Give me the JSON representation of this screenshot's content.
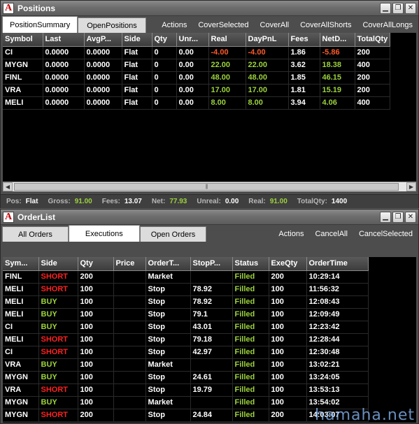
{
  "positions_window": {
    "title": "Positions",
    "tabs": [
      "PositionSummary",
      "OpenPositions"
    ],
    "actions": [
      "Actions",
      "CoverSelected",
      "CoverAll",
      "CoverAllShorts",
      "CoverAllLongs"
    ],
    "columns": [
      "Symbol",
      "Last",
      "AvgP...",
      "Side",
      "Qty",
      "Unr...",
      "Real",
      "DayPnL",
      "Fees",
      "NetD...",
      "TotalQty"
    ],
    "rows": [
      {
        "symbol": "CI",
        "last": "0.0000",
        "avg": "0.0000",
        "side": "Flat",
        "qty": "0",
        "unr": "0.00",
        "real": "-4.00",
        "daypnl": "-4.00",
        "fees": "1.86",
        "net": "-5.86",
        "total": "200"
      },
      {
        "symbol": "MYGN",
        "last": "0.0000",
        "avg": "0.0000",
        "side": "Flat",
        "qty": "0",
        "unr": "0.00",
        "real": "22.00",
        "daypnl": "22.00",
        "fees": "3.62",
        "net": "18.38",
        "total": "400"
      },
      {
        "symbol": "FINL",
        "last": "0.0000",
        "avg": "0.0000",
        "side": "Flat",
        "qty": "0",
        "unr": "0.00",
        "real": "48.00",
        "daypnl": "48.00",
        "fees": "1.85",
        "net": "46.15",
        "total": "200"
      },
      {
        "symbol": "VRA",
        "last": "0.0000",
        "avg": "0.0000",
        "side": "Flat",
        "qty": "0",
        "unr": "0.00",
        "real": "17.00",
        "daypnl": "17.00",
        "fees": "1.81",
        "net": "15.19",
        "total": "200"
      },
      {
        "symbol": "MELI",
        "last": "0.0000",
        "avg": "0.0000",
        "side": "Flat",
        "qty": "0",
        "unr": "0.00",
        "real": "8.00",
        "daypnl": "8.00",
        "fees": "3.94",
        "net": "4.06",
        "total": "400"
      }
    ],
    "status": {
      "pos_label": "Pos:",
      "pos_value": "Flat",
      "gross_label": "Gross:",
      "gross_value": "91.00",
      "fees_label": "Fees:",
      "fees_value": "13.07",
      "net_label": "Net:",
      "net_value": "77.93",
      "unreal_label": "Unreal:",
      "unreal_value": "0.00",
      "real_label": "Real:",
      "real_value": "91.00",
      "totalqty_label": "TotalQty:",
      "totalqty_value": "1400"
    }
  },
  "orders_window": {
    "title": "OrderList",
    "tabs": [
      "All Orders",
      "Executions",
      "Open Orders"
    ],
    "actions": [
      "Actions",
      "CancelAll",
      "CancelSelected"
    ],
    "columns": [
      "Sym...",
      "Side",
      "Qty",
      "Price",
      "OrderT...",
      "StopP...",
      "Status",
      "ExeQty",
      "OrderTime"
    ],
    "rows": [
      {
        "sym": "FINL",
        "side": "SHORT",
        "qty": "200",
        "price": "",
        "type": "Market",
        "stop": "",
        "status": "Filled",
        "exe": "200",
        "time": "10:29:14"
      },
      {
        "sym": "MELI",
        "side": "SHORT",
        "qty": "100",
        "price": "",
        "type": "Stop",
        "stop": "78.92",
        "status": "Filled",
        "exe": "100",
        "time": "11:56:32"
      },
      {
        "sym": "MELI",
        "side": "BUY",
        "qty": "100",
        "price": "",
        "type": "Stop",
        "stop": "78.92",
        "status": "Filled",
        "exe": "100",
        "time": "12:08:43"
      },
      {
        "sym": "MELI",
        "side": "BUY",
        "qty": "100",
        "price": "",
        "type": "Stop",
        "stop": "79.1",
        "status": "Filled",
        "exe": "100",
        "time": "12:09:49"
      },
      {
        "sym": "CI",
        "side": "BUY",
        "qty": "100",
        "price": "",
        "type": "Stop",
        "stop": "43.01",
        "status": "Filled",
        "exe": "100",
        "time": "12:23:42"
      },
      {
        "sym": "MELI",
        "side": "SHORT",
        "qty": "100",
        "price": "",
        "type": "Stop",
        "stop": "79.18",
        "status": "Filled",
        "exe": "100",
        "time": "12:28:44"
      },
      {
        "sym": "CI",
        "side": "SHORT",
        "qty": "100",
        "price": "",
        "type": "Stop",
        "stop": "42.97",
        "status": "Filled",
        "exe": "100",
        "time": "12:30:48"
      },
      {
        "sym": "VRA",
        "side": "BUY",
        "qty": "100",
        "price": "",
        "type": "Market",
        "stop": "",
        "status": "Filled",
        "exe": "100",
        "time": "13:02:21"
      },
      {
        "sym": "MYGN",
        "side": "BUY",
        "qty": "100",
        "price": "",
        "type": "Stop",
        "stop": "24.61",
        "status": "Filled",
        "exe": "100",
        "time": "13:24:05"
      },
      {
        "sym": "VRA",
        "side": "SHORT",
        "qty": "100",
        "price": "",
        "type": "Stop",
        "stop": "19.79",
        "status": "Filled",
        "exe": "100",
        "time": "13:53:13"
      },
      {
        "sym": "MYGN",
        "side": "BUY",
        "qty": "100",
        "price": "",
        "type": "Market",
        "stop": "",
        "status": "Filled",
        "exe": "100",
        "time": "13:54:02"
      },
      {
        "sym": "MYGN",
        "side": "SHORT",
        "qty": "200",
        "price": "",
        "type": "Stop",
        "stop": "24.84",
        "status": "Filled",
        "exe": "200",
        "time": "14:03:07"
      }
    ]
  },
  "watermark": "hamaha.net",
  "colors": {
    "positive": "#9cd23c",
    "negative": "#ff5a2a",
    "short": "#ff2020",
    "background": "#000000"
  },
  "icons": {
    "app": "app-logo-icon",
    "minimize": "minimize-icon",
    "restore": "restore-icon",
    "close": "close-icon"
  }
}
